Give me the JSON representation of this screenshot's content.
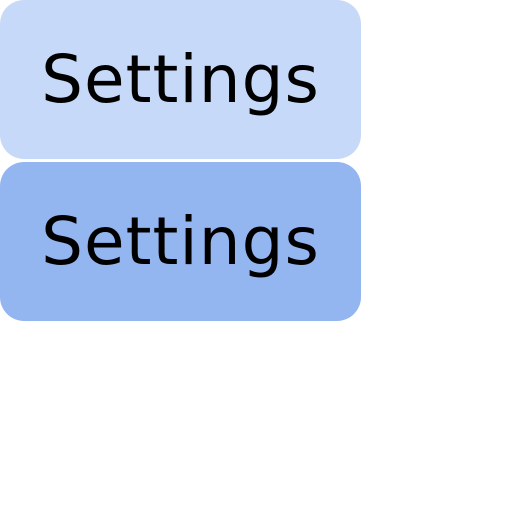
{
  "buttons": [
    {
      "label": "Settings",
      "color": "#c7d9f8",
      "state": "default"
    },
    {
      "label": "Settings",
      "color": "#93b5f0",
      "state": "hover"
    }
  ]
}
